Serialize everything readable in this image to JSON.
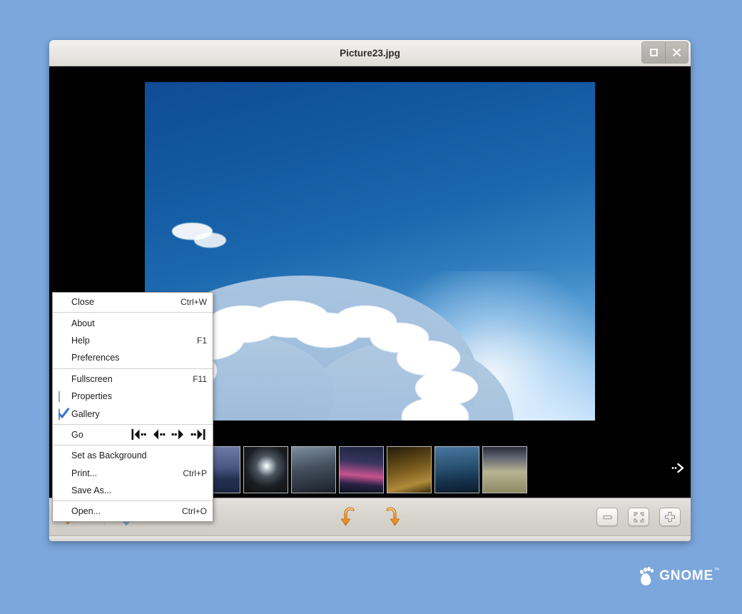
{
  "desktop": {
    "background_color": "#7ba7dd",
    "logo": {
      "text": "GNOME",
      "trademark": "™",
      "icon": "gnome-foot-icon"
    }
  },
  "window": {
    "title": "Picture23.jpg",
    "buttons": {
      "maximize": {
        "name": "maximize-button",
        "glyph": "□"
      },
      "close": {
        "name": "close-button",
        "glyph": "✕"
      }
    }
  },
  "image": {
    "alt": "Blue sky with sunbeams radiating behind a large white cloud",
    "background_color": "#000000"
  },
  "thumbnails": [
    {
      "label": "thumbnail-1",
      "c1": "#6a5437",
      "c2": "#2b2014"
    },
    {
      "label": "thumbnail-2",
      "c1": "#6f9cc4",
      "c2": "#3b3a5c"
    },
    {
      "label": "thumbnail-3",
      "c1": "#2f5f22",
      "c2": "#0c1a08"
    },
    {
      "label": "thumbnail-4",
      "c1": "#6d79a8",
      "c2": "#1a2540"
    },
    {
      "label": "thumbnail-5",
      "c1": "#d8d8d8",
      "c2": "#10100e"
    },
    {
      "label": "thumbnail-6",
      "c1": "#7e8fa0",
      "c2": "#1b2028"
    },
    {
      "label": "thumbnail-7",
      "c1": "#c8548f",
      "c2": "#0d1220"
    },
    {
      "label": "thumbnail-8",
      "c1": "#b08a3a",
      "c2": "#241a08"
    },
    {
      "label": "thumbnail-9",
      "c1": "#4a76a0",
      "c2": "#0d1c2c"
    },
    {
      "label": "thumbnail-10",
      "c1": "#b8b392",
      "c2": "#2a2c38"
    }
  ],
  "thumbstrip": {
    "next_icon": "next-arrow-icon"
  },
  "toolbar": {
    "gallery_zoom": {
      "name": "gallery-zoom-button",
      "icon": "image-magnifier-icon",
      "has_dropdown": true
    },
    "dropdown": {
      "name": "gallery-zoom-dropdown",
      "icon": "triangle-up-icon"
    },
    "fit_move": {
      "name": "move-fit-button",
      "icon": "four-arrows-square-icon"
    },
    "rotate_left": {
      "name": "rotate-counterclockwise-button",
      "icon": "rotate-left-arrow-icon"
    },
    "rotate_right": {
      "name": "rotate-clockwise-button",
      "icon": "rotate-right-arrow-icon"
    },
    "zoom_out": {
      "name": "zoom-out-button",
      "icon": "minus-icon"
    },
    "zoom_fit": {
      "name": "best-fit-button",
      "icon": "corners-fit-icon"
    },
    "zoom_in": {
      "name": "zoom-in-button",
      "icon": "plus-icon"
    }
  },
  "menu": {
    "items": [
      {
        "type": "item",
        "label": "Close",
        "accel": "Ctrl+W"
      },
      {
        "type": "separator"
      },
      {
        "type": "item",
        "label": "About",
        "accel": ""
      },
      {
        "type": "item",
        "label": "Help",
        "accel": "F1"
      },
      {
        "type": "item",
        "label": "Preferences",
        "accel": ""
      },
      {
        "type": "separator"
      },
      {
        "type": "item",
        "label": "Fullscreen",
        "accel": "F11"
      },
      {
        "type": "check",
        "label": "Properties",
        "accel": "",
        "checked": false
      },
      {
        "type": "check",
        "label": "Gallery",
        "accel": "",
        "checked": true
      },
      {
        "type": "separator"
      },
      {
        "type": "go",
        "label": "Go",
        "accel": ""
      },
      {
        "type": "separator"
      },
      {
        "type": "item",
        "label": "Set as Background",
        "accel": ""
      },
      {
        "type": "item",
        "label": "Print...",
        "accel": "Ctrl+P"
      },
      {
        "type": "item",
        "label": "Save As...",
        "accel": ""
      },
      {
        "type": "separator"
      },
      {
        "type": "item",
        "label": "Open...",
        "accel": "Ctrl+O"
      }
    ],
    "go_icons": [
      {
        "name": "go-first-icon",
        "title": "First Image"
      },
      {
        "name": "go-previous-icon",
        "title": "Previous Image"
      },
      {
        "name": "go-next-icon",
        "title": "Next Image"
      },
      {
        "name": "go-last-icon",
        "title": "Last Image"
      }
    ]
  }
}
